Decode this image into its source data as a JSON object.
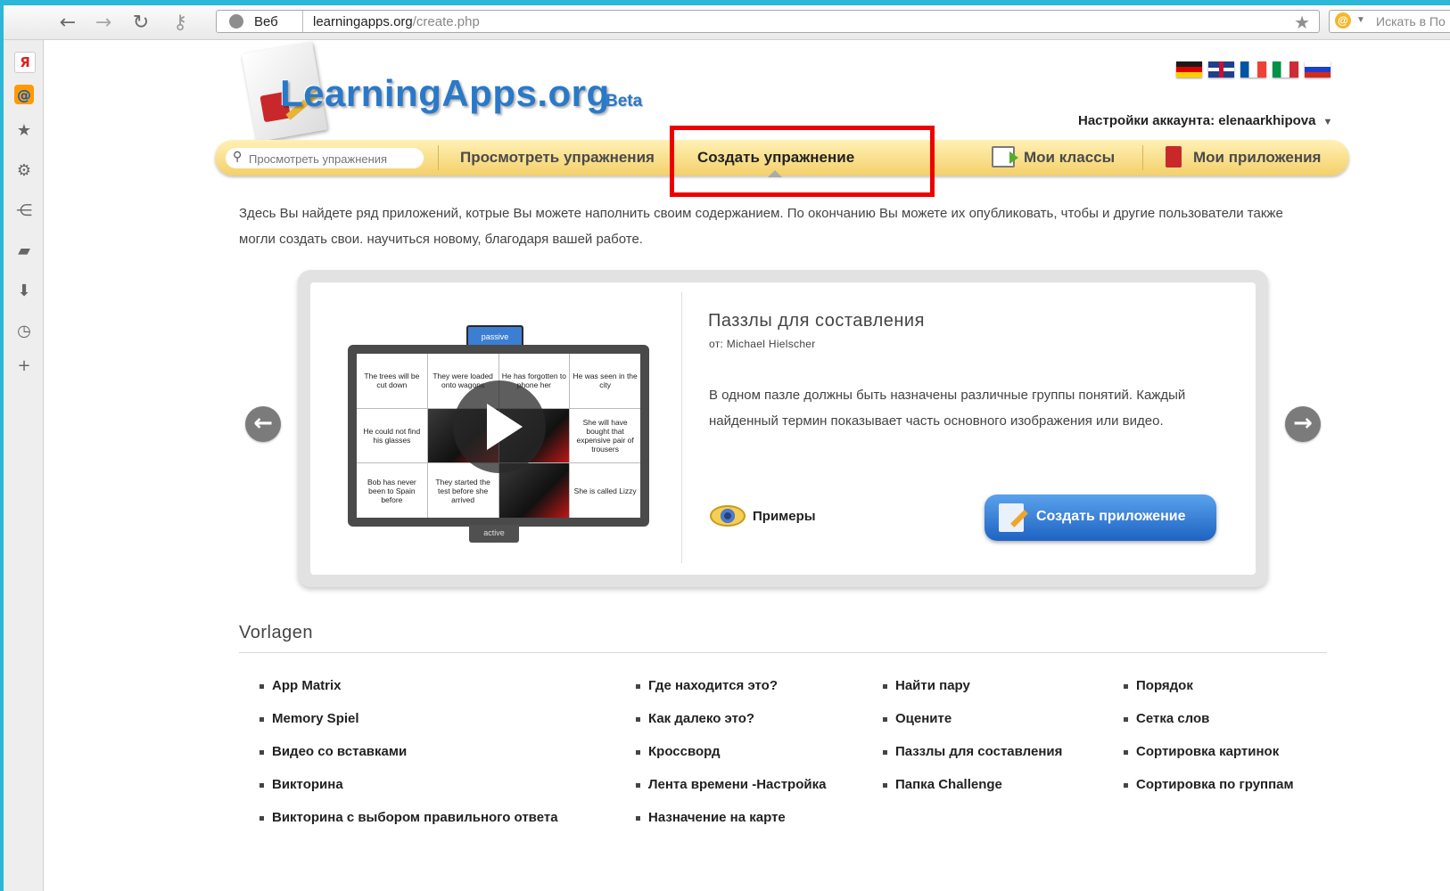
{
  "browser": {
    "web_label": "Веб",
    "url_host": "learningapps.org",
    "url_path": "/create.php",
    "search_placeholder": "Искать в По"
  },
  "sidepanel": {
    "yandex_label": "Я",
    "mail_label": "@"
  },
  "header": {
    "logo": "LearningApps.org",
    "beta": "Beta",
    "account_label": "Настройки аккаунта: elenaarkhipova",
    "flags": [
      "de",
      "gb",
      "fr",
      "it",
      "ru"
    ]
  },
  "nav": {
    "search_placeholder": "Просмотреть упражнения",
    "browse": "Просмотреть упражнения",
    "create": "Создать упражнение",
    "classes": "Мои классы",
    "apps": "Мои приложения"
  },
  "intro": "Здесь Вы найдете ряд приложений, котрые Вы можете наполнить своим содержанием. По окончанию Вы можете их опубликовать, чтобы и другие пользователи также могли создать свои. научиться новому, благодаря вашей работе.",
  "featured": {
    "title": "Паззлы для составления",
    "author": "от: Michael Hielscher",
    "description": "В одном пазле должны быть назначены различные группы понятий. Каждый найденный термин показывает часть основного изображения или видео.",
    "examples_label": "Примеры",
    "create_label": "Создать приложение",
    "thumb_tab_top": "passive",
    "thumb_tab_bottom": "active",
    "pieces": [
      "The trees will be cut down",
      "They were loaded onto wagons",
      "He has forgotten to phone her",
      "He was seen in the city",
      "He could not find his glasses",
      "",
      "",
      "She will have bought that expensive pair of trousers",
      "Bob has never been to Spain before",
      "They started the test before she arrived",
      "",
      "She is called Lizzy"
    ]
  },
  "vorlagen": {
    "title": "Vorlagen",
    "col1": [
      "App Matrix",
      "Memory Spiel",
      "Видео со вставками",
      "Викторина",
      "Викторина с выбором правильного ответа"
    ],
    "col2": [
      "Где находится это?",
      "Как далеко это?",
      "Кроссворд",
      "Лента времени -Настройка",
      "Назначение на карте"
    ],
    "col3": [
      "Найти пару",
      "Оцените",
      "Паззлы для составления",
      "Папка Challenge"
    ],
    "col4": [
      "Порядок",
      "Сетка слов",
      "Сортировка картинок",
      "Сортировка по группам"
    ]
  }
}
